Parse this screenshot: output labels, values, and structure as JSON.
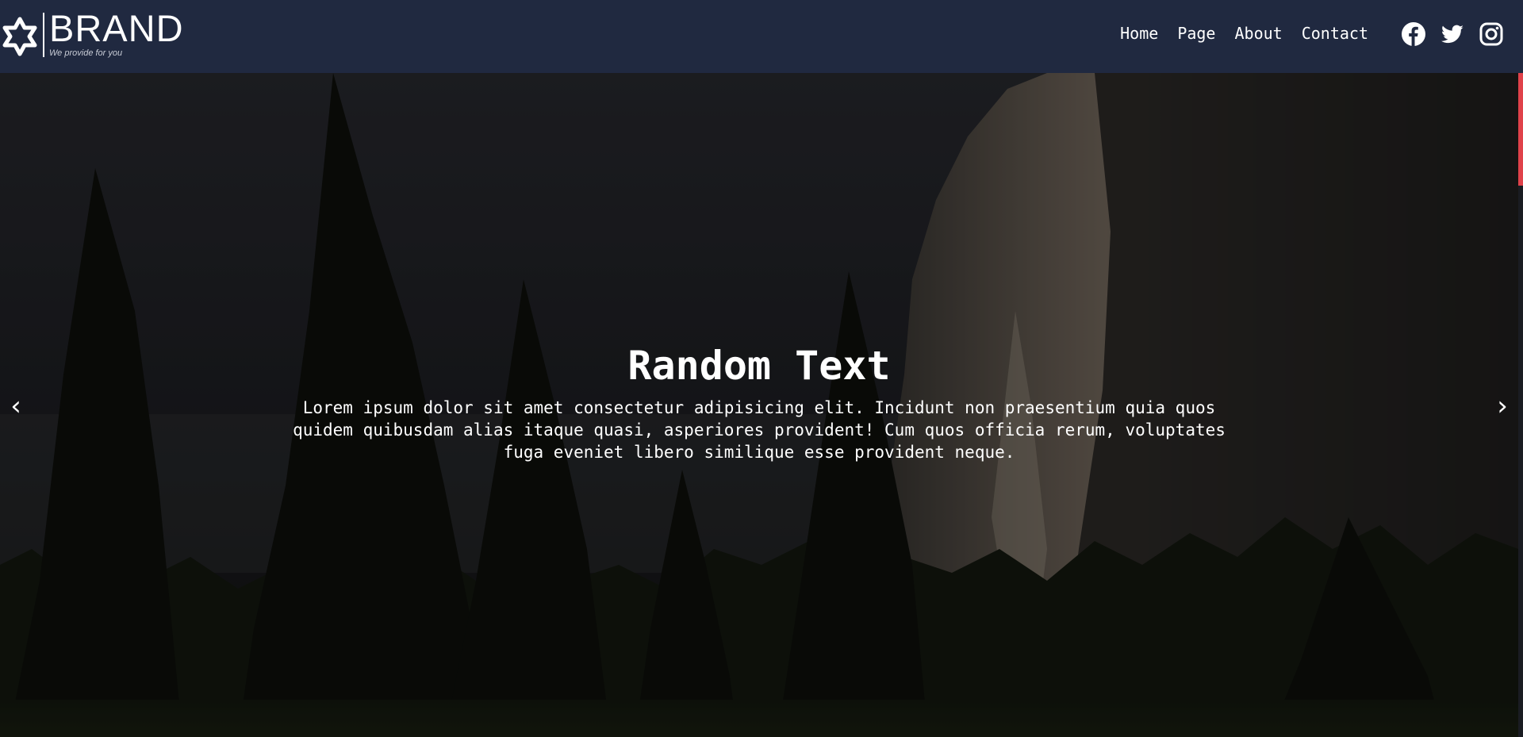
{
  "brand": {
    "name": "BRAND",
    "tagline": "We provide for you",
    "icon": "star-of-david-logo"
  },
  "nav": {
    "links": [
      "Home",
      "Page",
      "About",
      "Contact"
    ]
  },
  "socials": [
    "facebook-icon",
    "twitter-icon",
    "instagram-icon"
  ],
  "hero": {
    "title": "Random Text",
    "body": "Lorem ipsum dolor sit amet consectetur adipisicing elit. Incidunt non praesentium quia quos quidem quibusdam alias itaque quasi, asperiores provident! Cum quos officia rerum, voluptates fuga eveniet libero similique esse provident neque.",
    "prev_label": "‹",
    "next_label": "›"
  },
  "colors": {
    "navbar": "#202940",
    "accent": "#e0424a"
  }
}
